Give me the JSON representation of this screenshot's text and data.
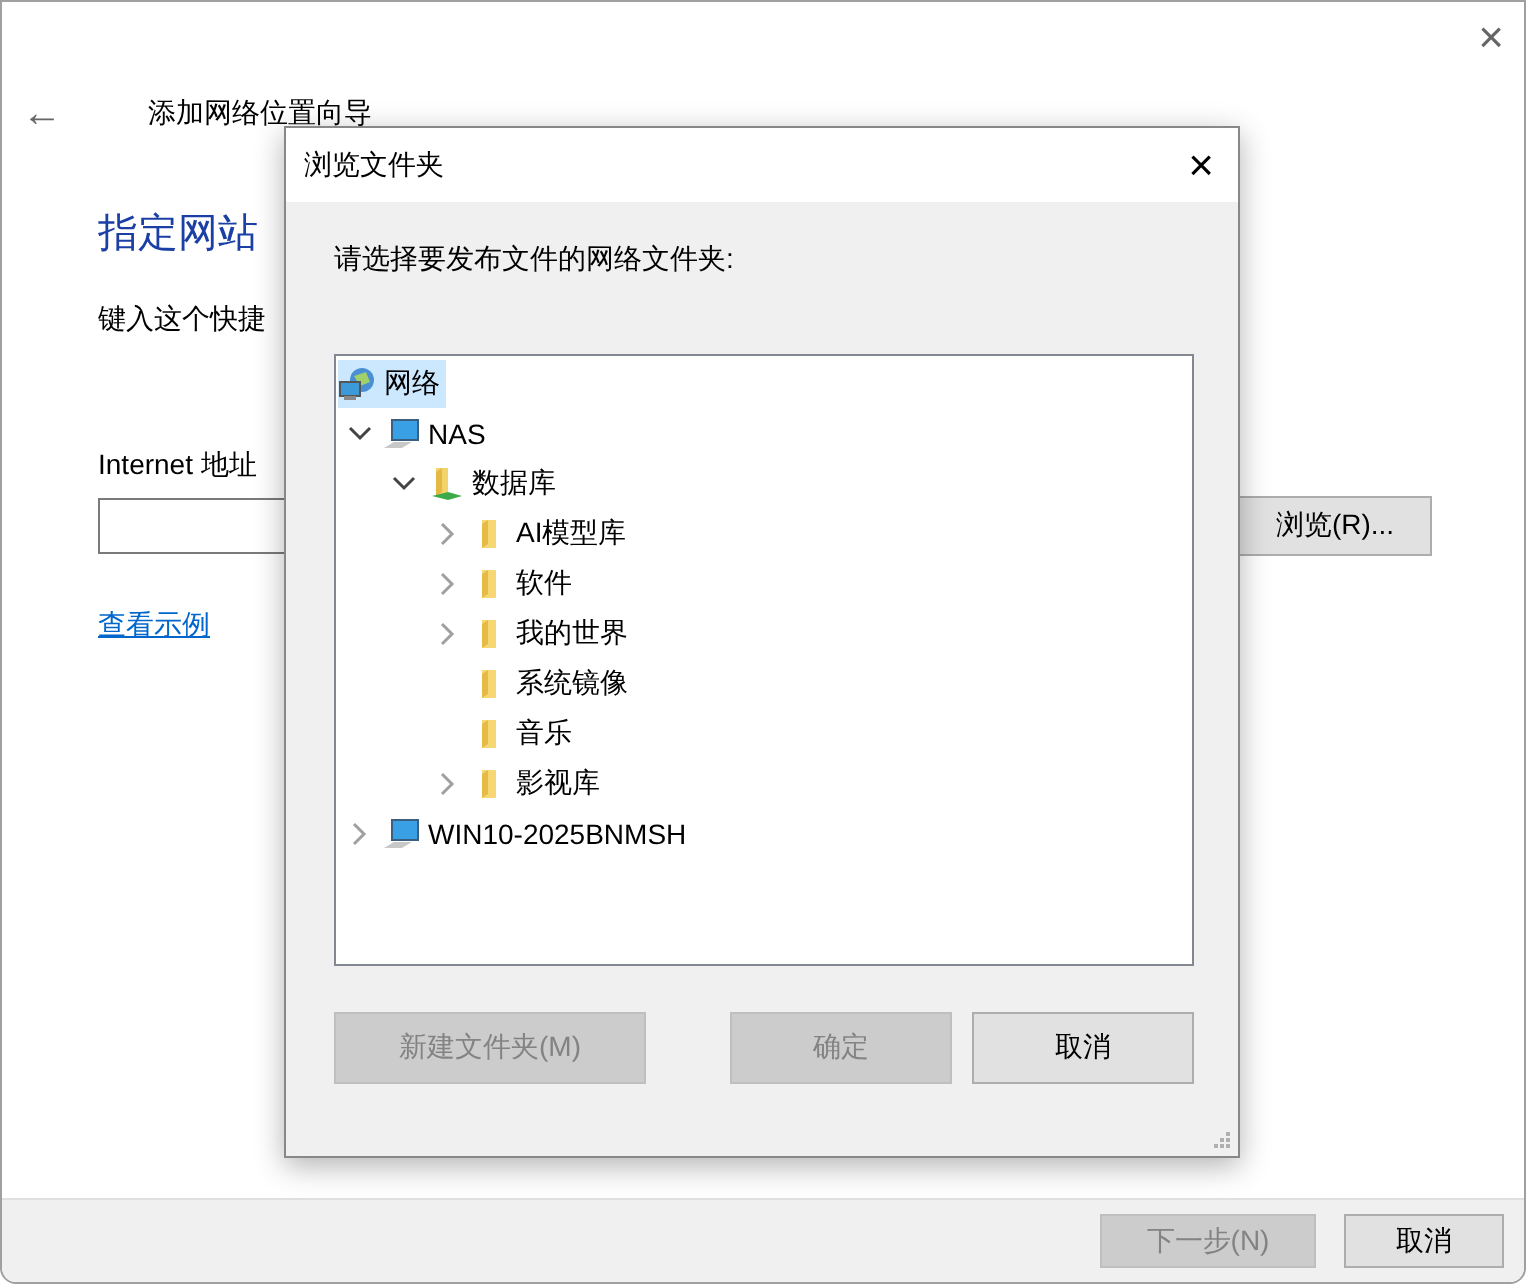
{
  "wizard": {
    "close": "×",
    "back": "←",
    "title": "添加网络位置向导",
    "heading": "指定网站",
    "instruction": "键入这个快捷",
    "address_label": "Internet 地址",
    "browse_button": "浏览(R)...",
    "example_link": "查看示例",
    "buttons": [
      {
        "label": "下一步(N)",
        "disabled": true
      },
      {
        "label": "取消",
        "disabled": false
      }
    ]
  },
  "dialog": {
    "title": "浏览文件夹",
    "close": "×",
    "prompt": "请选择要发布文件的网络文件夹:",
    "tree": [
      {
        "label": "网络",
        "kind": "network",
        "selected": true,
        "children": [
          {
            "label": "NAS",
            "kind": "computer",
            "selected": false,
            "expanded": true,
            "children": [
              {
                "label": "数据库",
                "kind": "share",
                "selected": false,
                "expanded": true,
                "children": [
                  {
                    "label": "AI模型库",
                    "kind": "folder",
                    "selected": false,
                    "expanded": false
                  },
                  {
                    "label": "软件",
                    "kind": "folder",
                    "selected": false,
                    "expanded": false
                  },
                  {
                    "label": "我的世界",
                    "kind": "folder",
                    "selected": false,
                    "expanded": false
                  },
                  {
                    "label": "系统镜像",
                    "kind": "folder",
                    "selected": false
                  },
                  {
                    "label": "音乐",
                    "kind": "folder",
                    "selected": false
                  },
                  {
                    "label": "影视库",
                    "kind": "folder",
                    "selected": false,
                    "expanded": false
                  }
                ]
              }
            ]
          },
          {
            "label": "WIN10-2025BNMSH",
            "kind": "computer",
            "selected": false,
            "expanded": false
          }
        ]
      }
    ],
    "buttons": [
      {
        "label": "新建文件夹(M)",
        "disabled": true
      },
      {
        "label": "确定",
        "disabled": true
      },
      {
        "label": "取消",
        "disabled": false
      }
    ]
  }
}
